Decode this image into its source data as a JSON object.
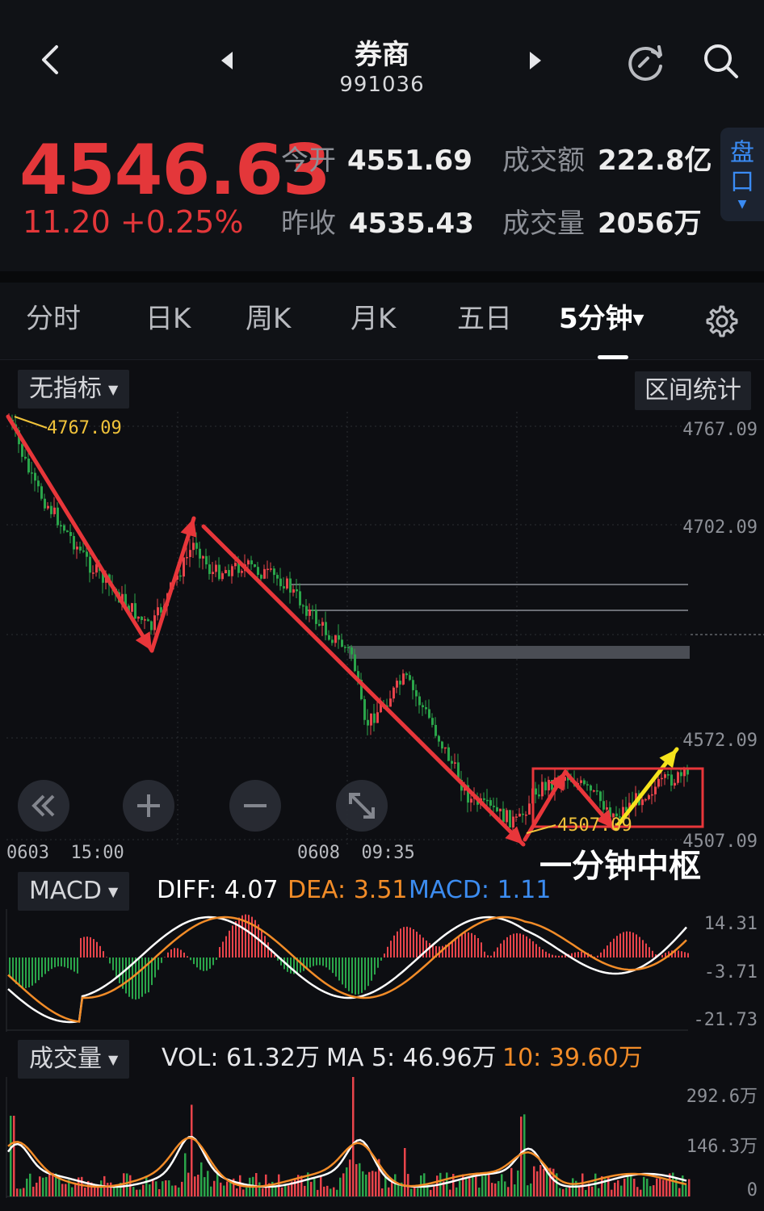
{
  "header": {
    "title": "券商",
    "code": "991036"
  },
  "quote": {
    "price": "4546.63",
    "change": "11.20 +0.25%",
    "open_label": "今开",
    "open_value": "4551.69",
    "prev_close_label": "昨收",
    "prev_close_value": "4535.43",
    "turnover_label": "成交额",
    "turnover_value": "222.8亿",
    "volume_label": "成交量",
    "volume_value": "2056万",
    "pankou_label": "盘口"
  },
  "tabs": [
    {
      "label": "分时",
      "active": false
    },
    {
      "label": "日K",
      "active": false
    },
    {
      "label": "周K",
      "active": false
    },
    {
      "label": "月K",
      "active": false
    },
    {
      "label": "五日",
      "active": false
    },
    {
      "label": "5分钟",
      "active": true
    }
  ],
  "main_chart": {
    "indicator_label": "无指标",
    "range_stats_label": "区间统计",
    "high_marker": "4767.09",
    "low_marker": "4507.09",
    "y_labels": [
      "4767.09",
      "4702.09",
      "4572.09",
      "4507.09"
    ],
    "time_labels": [
      "0603  15:00",
      "0608  09:35"
    ],
    "annotation": "一分钟中枢",
    "colors": {
      "up": "#e9444b",
      "down": "#2aa54a",
      "arrow_red": "#e8363a",
      "arrow_yellow": "#f5e31c",
      "box": "#e8363a"
    }
  },
  "macd": {
    "label": "MACD",
    "diff": "DIFF: 4.07",
    "dea": "DEA: 3.51",
    "macd": "MACD: 1.11",
    "y_labels": [
      "14.31",
      "-3.71",
      "-21.73"
    ],
    "colors": {
      "diff": "#ffffff",
      "dea": "#f28c28",
      "macd_label": "#3c8cf0"
    }
  },
  "volume": {
    "label": "成交量",
    "vol": "VOL: 61.32万",
    "ma5": "MA 5: 46.96万",
    "ma10": "10: 39.60万",
    "y_labels": [
      "292.6万",
      "146.3万",
      "0"
    ],
    "colors": {
      "ma10": "#f28c28"
    }
  }
}
